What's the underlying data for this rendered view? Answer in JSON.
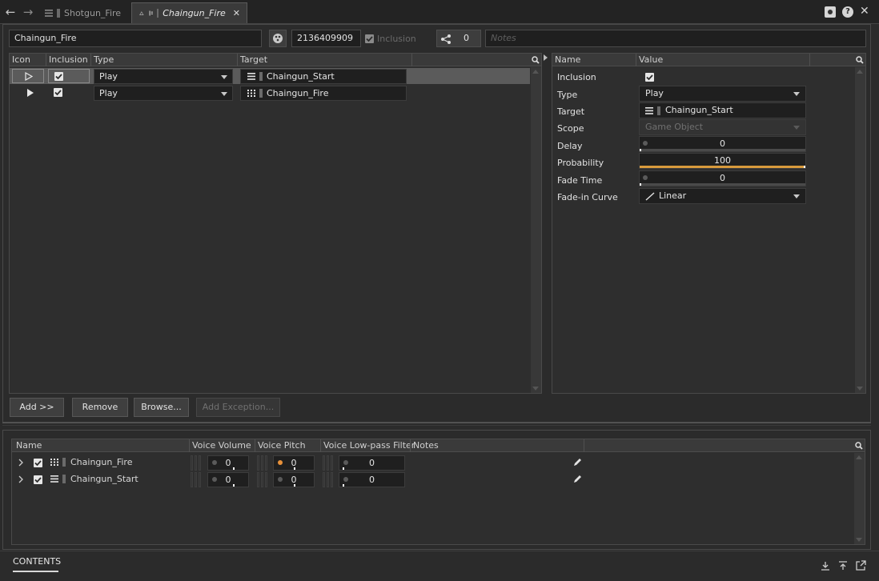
{
  "tabs": [
    {
      "label": "Shotgun_Fire",
      "active": false
    },
    {
      "label": "Chaingun_Fire",
      "active": true
    }
  ],
  "header": {
    "name": "Chaingun_Fire",
    "short_id": "2136409909",
    "inclusion_label": "Inclusion",
    "share_count": "0",
    "notes_placeholder": "Notes"
  },
  "entries_table": {
    "columns": [
      "Icon",
      "Inclusion",
      "Type",
      "Target"
    ],
    "rows": [
      {
        "type": "Play",
        "target": "Chaingun_Start",
        "target_icon": "list-icon",
        "selected": true,
        "included": true
      },
      {
        "type": "Play",
        "target": "Chaingun_Fire",
        "target_icon": "grid-icon",
        "selected": false,
        "included": true
      }
    ]
  },
  "buttons": {
    "add": "Add >>",
    "remove": "Remove",
    "browse": "Browse...",
    "add_exception": "Add Exception..."
  },
  "properties": {
    "columns": [
      "Name",
      "Value"
    ],
    "inclusion": {
      "label": "Inclusion",
      "checked": true
    },
    "type": {
      "label": "Type",
      "value": "Play"
    },
    "target": {
      "label": "Target",
      "value": "Chaingun_Start"
    },
    "scope": {
      "label": "Scope",
      "value": "Game Object"
    },
    "delay": {
      "label": "Delay",
      "value": "0",
      "fill": 0
    },
    "probability": {
      "label": "Probability",
      "value": "100",
      "fill": 1
    },
    "fade_time": {
      "label": "Fade Time",
      "value": "0",
      "fill": 0
    },
    "fade_curve": {
      "label": "Fade-in Curve",
      "value": "Linear"
    }
  },
  "contents": {
    "columns": [
      "Name",
      "Voice Volume",
      "Voice Pitch",
      "Voice Low-pass Filter",
      "Notes"
    ],
    "rows": [
      {
        "name": "Chaingun_Fire",
        "icon": "grid-icon",
        "volume": "0",
        "pitch": "0",
        "lpf": "0"
      },
      {
        "name": "Chaingun_Start",
        "icon": "list-icon",
        "volume": "0",
        "pitch": "0",
        "lpf": "0"
      }
    ],
    "tab_label": "CONTENTS"
  },
  "colors": {
    "accent_orange": "#d89a3c",
    "selected_row": "#5b5b5b",
    "background": "#2b2b2b"
  }
}
